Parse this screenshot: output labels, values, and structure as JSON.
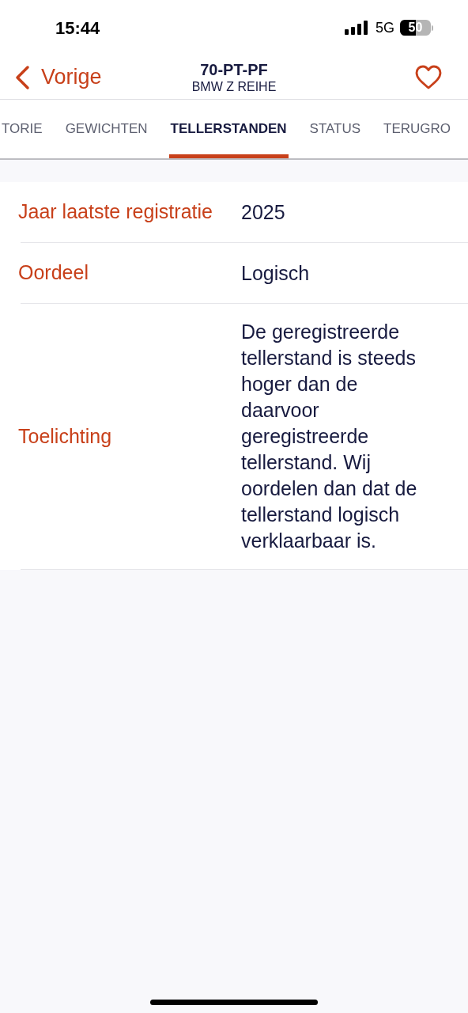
{
  "status_bar": {
    "time": "15:44",
    "network": "5G",
    "battery": "50"
  },
  "nav": {
    "back": "Vorige",
    "title": "70-PT-PF",
    "subtitle": "BMW Z REIHE",
    "favorite": false
  },
  "tabs": [
    {
      "label": "TORIE",
      "selected": false
    },
    {
      "label": "GEWICHTEN",
      "selected": false
    },
    {
      "label": "TELLERSTANDEN",
      "selected": true
    },
    {
      "label": "STATUS",
      "selected": false
    },
    {
      "label": "TERUGRO",
      "selected": false
    }
  ],
  "rows": [
    {
      "label": "Jaar laatste registratie",
      "value": "2025"
    },
    {
      "label": "Oordeel",
      "value": "Logisch"
    },
    {
      "label": "Toelichting",
      "value": "De geregistreerde tellerstand is steeds hoger dan de daarvoor geregistreerde tellerstand. Wij oordelen dan dat de tellerstand logisch verklaarbaar is."
    }
  ]
}
